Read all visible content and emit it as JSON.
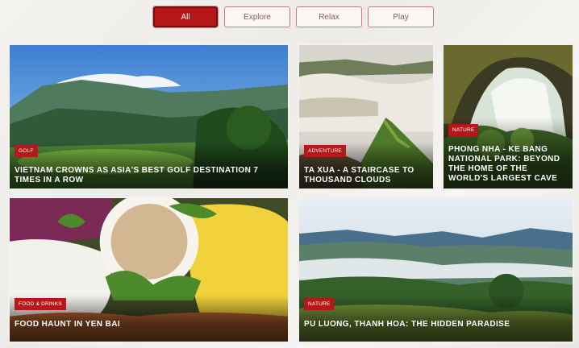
{
  "filters": [
    {
      "label": "All",
      "active": true
    },
    {
      "label": "Explore",
      "active": false
    },
    {
      "label": "Relax",
      "active": false
    },
    {
      "label": "Play",
      "active": false
    }
  ],
  "cards": [
    {
      "category": "GOLF",
      "title": "VIETNAM CROWNS AS ASIA'S BEST GOLF DESTINATION 7 TIMES IN A ROW",
      "image": "mountain-golf-course"
    },
    {
      "category": "ADVENTURE",
      "title": "TA XUA - A STAIRCASE TO THOUSAND CLOUDS",
      "image": "mountain-ridge-clouds"
    },
    {
      "category": "NATURE",
      "title": "PHONG NHA - KE BANG NATIONAL PARK: BEYOND THE HOME OF THE WORLD'S LARGEST CAVE",
      "image": "cave-entrance"
    },
    {
      "category": "FOOD & DRINKS",
      "title": "FOOD HAUNT IN YEN BAI",
      "image": "colorful-sticky-rice"
    },
    {
      "category": "NATURE",
      "title": "PU LUONG, THANH HOA: THE HIDDEN PARADISE",
      "image": "valley-mist-mountains"
    }
  ],
  "colors": {
    "accent": "#b8171a"
  }
}
